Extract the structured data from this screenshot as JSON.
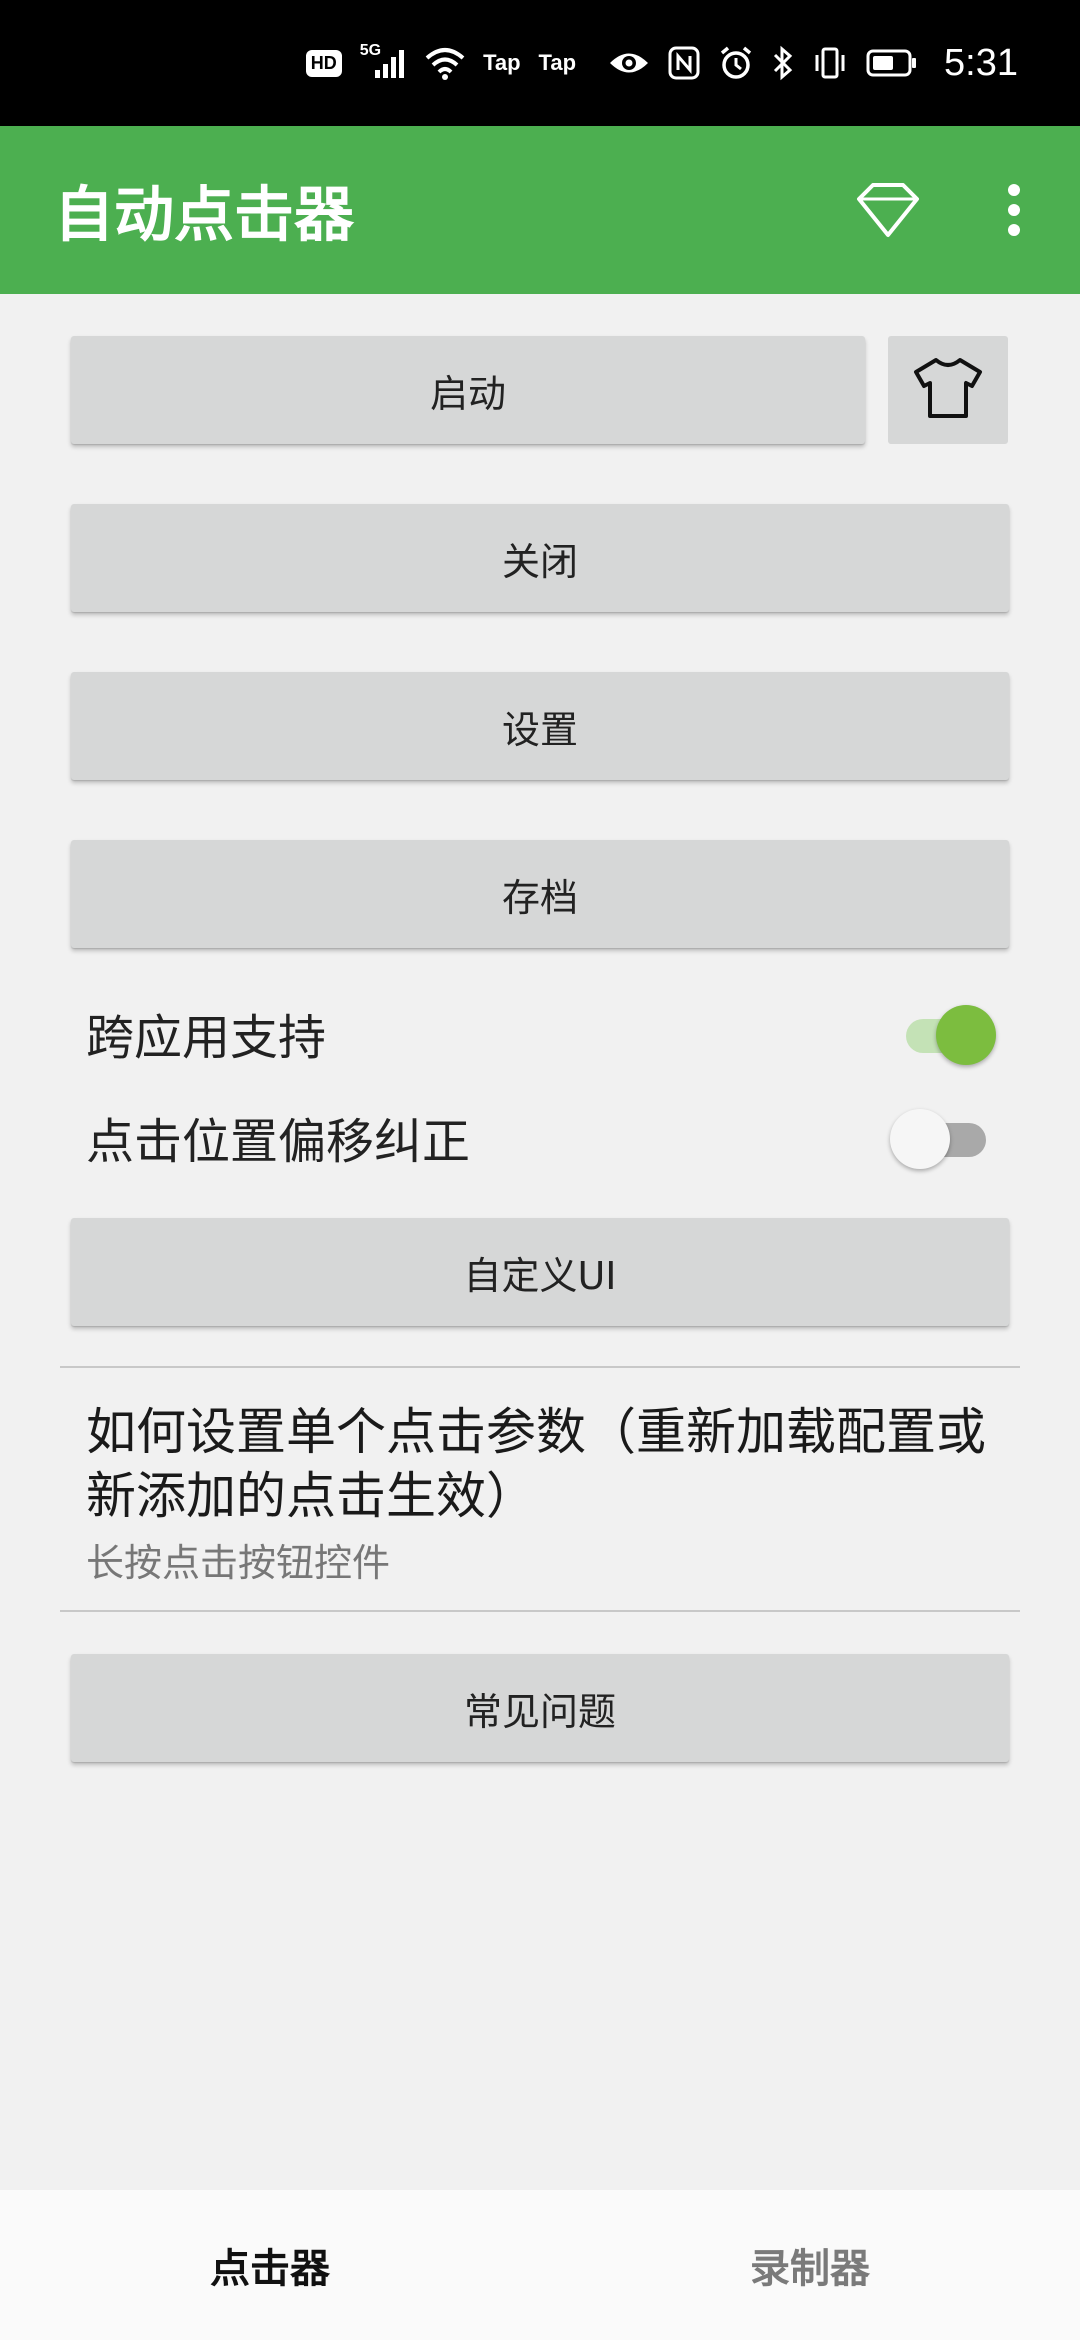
{
  "status_bar": {
    "hd": "HD",
    "signal_gen": "5G",
    "app_indicator_1": "Tap",
    "app_indicator_2": "Tap",
    "time": "5:31",
    "icons": [
      "hd-icon",
      "signal-icon",
      "wifi-icon",
      "eye-icon",
      "nfc-icon",
      "alarm-icon",
      "bluetooth-icon",
      "vibrate-icon",
      "battery-icon"
    ]
  },
  "app_bar": {
    "title": "自动点击器",
    "icons": [
      "diamond-icon",
      "more-vert-icon"
    ],
    "color": "#4caf50"
  },
  "buttons": {
    "start": "启动",
    "close": "关闭",
    "settings": "设置",
    "archive": "存档",
    "custom_ui": "自定义UI",
    "faq": "常见问题",
    "shirt_icon": "tshirt-icon"
  },
  "toggles": {
    "cross_app": {
      "label": "跨应用支持",
      "on": true
    },
    "offset_correction": {
      "label": "点击位置偏移纠正",
      "on": false
    },
    "on_color": "#7cbd3f"
  },
  "info": {
    "title": "如何设置单个点击参数（重新加载配置或新添加的点击生效）",
    "subtitle": "长按点击按钮控件"
  },
  "bottom_nav": {
    "tabs": [
      {
        "label": "点击器",
        "active": true
      },
      {
        "label": "录制器",
        "active": false
      }
    ]
  }
}
